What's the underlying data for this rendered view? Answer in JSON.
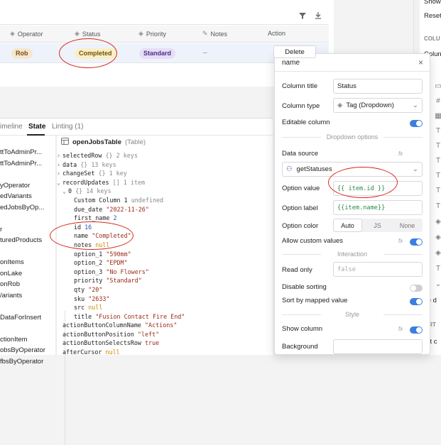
{
  "table": {
    "columns": [
      {
        "label": "Operator",
        "icon": "tag-icon"
      },
      {
        "label": "Status",
        "icon": "tag-icon"
      },
      {
        "label": "Priority",
        "icon": "tag-icon"
      },
      {
        "label": "Notes",
        "icon": "text-icon"
      },
      {
        "label": "Action",
        "icon": ""
      }
    ],
    "row": {
      "operator": "Rob",
      "status": "Completed",
      "priority": "Standard",
      "notes": "–",
      "action": "Delete"
    }
  },
  "bottom_tabs": [
    {
      "label": "imeline"
    },
    {
      "label": "State"
    },
    {
      "label": "Linting (1)"
    }
  ],
  "left_list": [
    "ttToAdminPr...",
    "ttToAdminPr...",
    "",
    "yOperator",
    "edVariants",
    "edJobsByOp...",
    "",
    "r",
    "turedProducts",
    "",
    "onItems",
    "onLake",
    "onRob",
    "/ariants",
    "",
    "DataForInsert",
    "",
    "ctionItem",
    "obsByOperator",
    "fbsByOperator"
  ],
  "state_header": {
    "name": "openJobsTable",
    "type": "(Table)"
  },
  "state_tree": [
    {
      "indent": 0,
      "arrow": "›",
      "key": "selectedRow",
      "meta": "{} 2 keys"
    },
    {
      "indent": 0,
      "arrow": "›",
      "key": "data",
      "meta": "{} 13 keys"
    },
    {
      "indent": 0,
      "arrow": "›",
      "key": "changeSet",
      "meta": "{} 1 key"
    },
    {
      "indent": 0,
      "arrow": "⌄",
      "key": "recordUpdates",
      "meta": "[] 1 item"
    },
    {
      "indent": 1,
      "arrow": "⌄",
      "key": "0",
      "meta": "{} 14 keys"
    },
    {
      "indent": 2,
      "arrow": "",
      "key": "Custom Column 1",
      "value": "undefined",
      "vtype": "undef"
    },
    {
      "indent": 2,
      "arrow": "",
      "key": "due_date",
      "value": "\"2022-11-26\"",
      "vtype": "str"
    },
    {
      "indent": 2,
      "arrow": "",
      "key": "first_name",
      "value": "2",
      "vtype": "num"
    },
    {
      "indent": 2,
      "arrow": "",
      "key": "id",
      "value": "16",
      "vtype": "num"
    },
    {
      "indent": 2,
      "arrow": "",
      "key": "name",
      "value": "\"Completed\"",
      "vtype": "str"
    },
    {
      "indent": 2,
      "arrow": "",
      "key": "notes",
      "value": "null",
      "vtype": "nul"
    },
    {
      "indent": 2,
      "arrow": "",
      "key": "option_1",
      "value": "\"590mm\"",
      "vtype": "str"
    },
    {
      "indent": 2,
      "arrow": "",
      "key": "option_2",
      "value": "\"EPDM\"",
      "vtype": "str"
    },
    {
      "indent": 2,
      "arrow": "",
      "key": "option_3",
      "value": "\"No Flowers\"",
      "vtype": "str"
    },
    {
      "indent": 2,
      "arrow": "",
      "key": "priority",
      "value": "\"Standard\"",
      "vtype": "str"
    },
    {
      "indent": 2,
      "arrow": "",
      "key": "qty",
      "value": "\"20\"",
      "vtype": "str"
    },
    {
      "indent": 2,
      "arrow": "",
      "key": "sku",
      "value": "\"2633\"",
      "vtype": "str"
    },
    {
      "indent": 2,
      "arrow": "",
      "key": "src",
      "value": "null",
      "vtype": "nul"
    },
    {
      "indent": 2,
      "arrow": "",
      "key": "title",
      "value": "\"Fusion Contact Fire End\"",
      "vtype": "str"
    },
    {
      "indent": 0,
      "arrow": "",
      "key": "actionButtonColumnName",
      "value": "\"Actions\"",
      "vtype": "str"
    },
    {
      "indent": 0,
      "arrow": "",
      "key": "actionButtonPosition",
      "value": "\"left\"",
      "vtype": "str"
    },
    {
      "indent": 0,
      "arrow": "",
      "key": "actionButtonSelectsRow",
      "value": "true",
      "vtype": "bool"
    },
    {
      "indent": 0,
      "arrow": "",
      "key": "afterCursor",
      "value": "null",
      "vtype": "nul"
    }
  ],
  "inspector": {
    "title": "name",
    "column_title_label": "Column title",
    "column_title_value": "Status",
    "column_type_label": "Column type",
    "column_type_value": "Tag (Dropdown)",
    "editable_label": "Editable column",
    "dropdown_section": "Dropdown options",
    "data_source_label": "Data source",
    "data_source_value": "getStatuses",
    "option_value_label": "Option value",
    "option_value_value": "{{ item.id }}",
    "option_label_label": "Option label",
    "option_label_value": "{{item.name}}",
    "option_color_label": "Option color",
    "option_color_options": [
      "Auto",
      "JS",
      "None"
    ],
    "allow_custom_label": "Allow custom values",
    "interaction_section": "Interaction",
    "read_only_label": "Read only",
    "read_only_placeholder": "false",
    "disable_sorting_label": "Disable sorting",
    "sort_mapped_label": "Sort by mapped value",
    "style_section": "Style",
    "show_column_label": "Show column",
    "background_label": "Background",
    "fx": "fx"
  },
  "right_strip": {
    "texts": [
      "Show",
      "Reset",
      "COLU",
      "Colum",
      "se d",
      "ORT",
      "ort c"
    ]
  },
  "colors": {
    "accent": "#3c7fe0",
    "annotation": "#d8261b",
    "operator_tag": "#f6e6cf",
    "status_tag": "#fbeec6",
    "priority_tag": "#e6def6"
  }
}
